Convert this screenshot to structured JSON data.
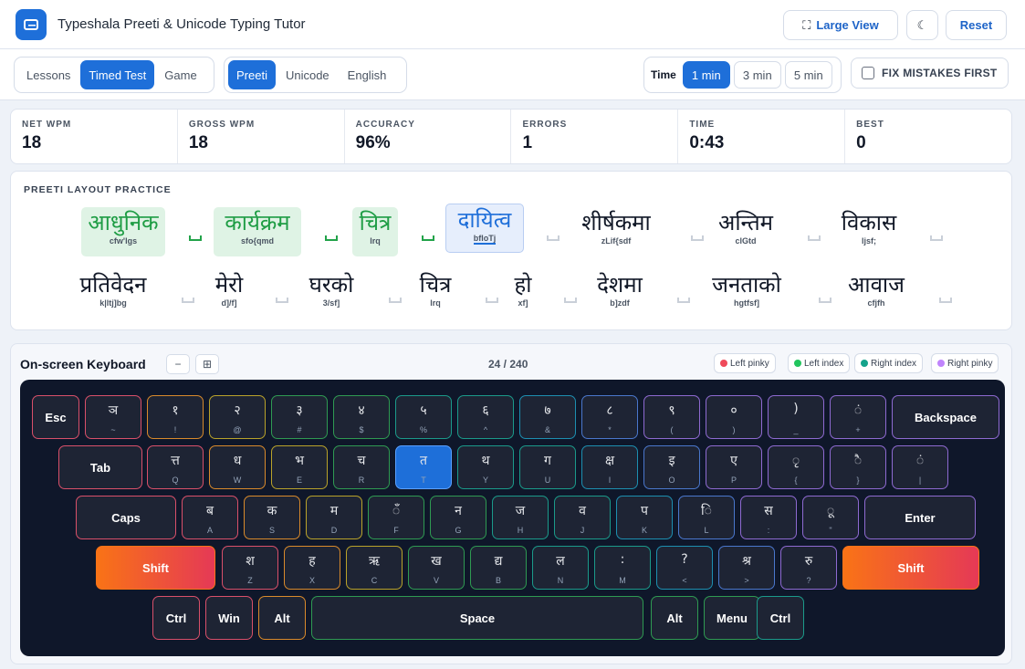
{
  "header": {
    "title": "Typeshala Preeti & Unicode Typing Tutor",
    "large_view": "Large View",
    "reset": "Reset"
  },
  "modes": {
    "tabs": [
      "Lessons",
      "Timed Test",
      "Game"
    ],
    "active_tab": "Timed Test",
    "layouts": [
      "Preeti",
      "Unicode",
      "English"
    ],
    "active_layout": "Preeti",
    "time_label": "Time",
    "time_options": [
      "1 min",
      "3 min",
      "5 min"
    ],
    "active_time": "1 min",
    "fix_mistakes": "FIX MISTAKES FIRST"
  },
  "stats": [
    {
      "label": "NET WPM",
      "value": "18"
    },
    {
      "label": "GROSS WPM",
      "value": "18"
    },
    {
      "label": "ACCURACY",
      "value": "96%"
    },
    {
      "label": "ERRORS",
      "value": "1"
    },
    {
      "label": "TIME",
      "value": "0:43"
    },
    {
      "label": "BEST",
      "value": "0"
    }
  ],
  "practice": {
    "title": "PREETI LAYOUT PRACTICE",
    "words": [
      {
        "dev": "आधुनिक",
        "rom": "cfw'lgs",
        "state": "done"
      },
      {
        "dev": "कार्यक्रम",
        "rom": "sfo{qmd",
        "state": "done"
      },
      {
        "dev": "चित्र",
        "rom": "lrq",
        "state": "done"
      },
      {
        "dev": "दायित्व",
        "rom": "bfloTj",
        "state": "current"
      },
      {
        "dev": "शीर्षकमा",
        "rom": "zLif{sdf",
        "state": "pending"
      },
      {
        "dev": "अन्तिम",
        "rom": "clGtd",
        "state": "pending"
      },
      {
        "dev": "विकास",
        "rom": "ljsf;",
        "state": "pending"
      },
      {
        "dev": "प्रतिवेदन",
        "rom": "k|ltj]bg",
        "state": "pending"
      },
      {
        "dev": "मेरो",
        "rom": "d]/f]",
        "state": "pending"
      },
      {
        "dev": "घरको",
        "rom": "3/sf]",
        "state": "pending"
      },
      {
        "dev": "चित्र",
        "rom": "lrq",
        "state": "pending"
      },
      {
        "dev": "हो",
        "rom": "xf]",
        "state": "pending"
      },
      {
        "dev": "देशमा",
        "rom": "b]zdf",
        "state": "pending"
      },
      {
        "dev": "जनताको",
        "rom": "hgtfsf]",
        "state": "pending"
      },
      {
        "dev": "आवाज",
        "rom": "cfjfh",
        "state": "pending"
      }
    ]
  },
  "keyboard": {
    "title": "On-screen Keyboard",
    "minus": "−",
    "grid_icon": "grid-icon",
    "progress": "24 / 240",
    "legend": [
      {
        "label": "Left pinky",
        "color": "#ef4a5a"
      },
      {
        "label": "Left index",
        "color": "#22c55e"
      },
      {
        "label": "Right index",
        "color": "#14a38b"
      },
      {
        "label": "Right pinky",
        "color": "#c084fc"
      }
    ],
    "rows": [
      [
        {
          "label": "Esc"
        },
        {
          "top": "ञ",
          "bot": "~"
        },
        {
          "top": "१",
          "bot": "!"
        },
        {
          "top": "२",
          "bot": "@"
        },
        {
          "top": "३",
          "bot": "#"
        },
        {
          "top": "४",
          "bot": "$"
        },
        {
          "top": "५",
          "bot": "%"
        },
        {
          "top": "६",
          "bot": "^"
        },
        {
          "top": "७",
          "bot": "&"
        },
        {
          "top": "८",
          "bot": "*"
        },
        {
          "top": "९",
          "bot": "("
        },
        {
          "top": "०",
          "bot": ")"
        },
        {
          "top": ")",
          "bot": "_"
        },
        {
          "top": "ं",
          "bot": "+"
        },
        {
          "label": "Backspace"
        }
      ],
      [
        {
          "label": "Tab"
        },
        {
          "top": "त्त",
          "bot": "Q"
        },
        {
          "top": "ध",
          "bot": "W"
        },
        {
          "top": "भ",
          "bot": "E"
        },
        {
          "top": "च",
          "bot": "R"
        },
        {
          "top": "त",
          "bot": "T",
          "active": true
        },
        {
          "top": "थ",
          "bot": "Y"
        },
        {
          "top": "ग",
          "bot": "U"
        },
        {
          "top": "क्ष",
          "bot": "I"
        },
        {
          "top": "इ",
          "bot": "O"
        },
        {
          "top": "ए",
          "bot": "P"
        },
        {
          "top": "ृ",
          "bot": "{"
        },
        {
          "top": "ै",
          "bot": "}"
        },
        {
          "top": "ं",
          "bot": "|"
        }
      ],
      [
        {
          "label": "Caps"
        },
        {
          "top": "ब",
          "bot": "A"
        },
        {
          "top": "क",
          "bot": "S"
        },
        {
          "top": "म",
          "bot": "D"
        },
        {
          "top": "ँ",
          "bot": "F"
        },
        {
          "top": "न",
          "bot": "G"
        },
        {
          "top": "ज",
          "bot": "H"
        },
        {
          "top": "व",
          "bot": "J"
        },
        {
          "top": "प",
          "bot": "K"
        },
        {
          "top": "ि",
          "bot": "L"
        },
        {
          "top": "स",
          "bot": ":"
        },
        {
          "top": "ू",
          "bot": "\""
        },
        {
          "label": "Enter"
        }
      ],
      [
        {
          "label": "Shift",
          "shift": true
        },
        {
          "top": "श",
          "bot": "Z"
        },
        {
          "top": "ह",
          "bot": "X"
        },
        {
          "top": "ऋ",
          "bot": "C"
        },
        {
          "top": "ख",
          "bot": "V"
        },
        {
          "top": "द्य",
          "bot": "B"
        },
        {
          "top": "ल",
          "bot": "N"
        },
        {
          "top": ":",
          "bot": "M"
        },
        {
          "top": "?",
          "bot": "<"
        },
        {
          "top": "श्र",
          "bot": ">"
        },
        {
          "top": "रु",
          "bot": "?"
        },
        {
          "label": "Shift",
          "shift": true
        }
      ],
      [
        {
          "label": "Ctrl"
        },
        {
          "label": "Win"
        },
        {
          "label": "Alt"
        },
        {
          "label": "Space"
        },
        {
          "label": "Alt"
        },
        {
          "label": "Menu"
        },
        {
          "label": "Ctrl"
        }
      ]
    ]
  }
}
